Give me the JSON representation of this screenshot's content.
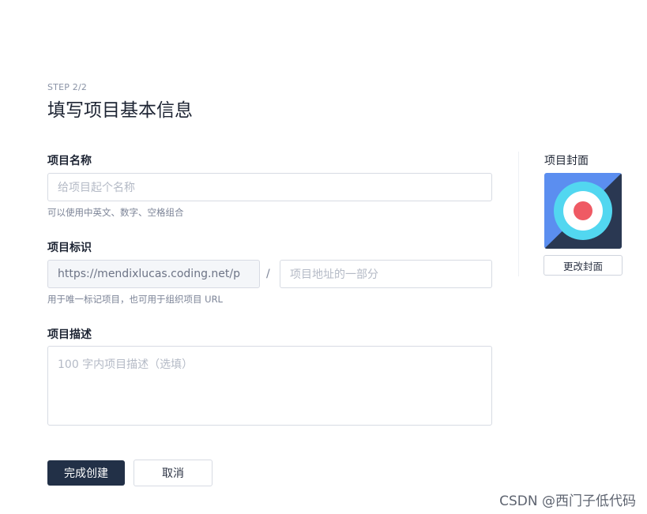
{
  "header": {
    "step": "STEP 2/2",
    "title": "填写项目基本信息"
  },
  "form": {
    "name": {
      "label": "项目名称",
      "placeholder": "给项目起个名称",
      "hint": "可以使用中英文、数字、空格组合"
    },
    "identifier": {
      "label": "项目标识",
      "prefix": "https://mendixlucas.coding.net/p",
      "separator": "/",
      "placeholder": "项目地址的一部分",
      "hint": "用于唯一标记项目，也可用于组织项目 URL"
    },
    "description": {
      "label": "项目描述",
      "placeholder": "100 字内项目描述（选填）"
    }
  },
  "cover": {
    "label": "项目封面",
    "change_label": "更改封面",
    "colors": {
      "background": "#5b8ef0",
      "dark": "#2a3852",
      "ring": "#52d7f0",
      "center": "#ef5a64"
    }
  },
  "actions": {
    "submit_label": "完成创建",
    "cancel_label": "取消"
  },
  "watermark": "CSDN @西门子低代码"
}
